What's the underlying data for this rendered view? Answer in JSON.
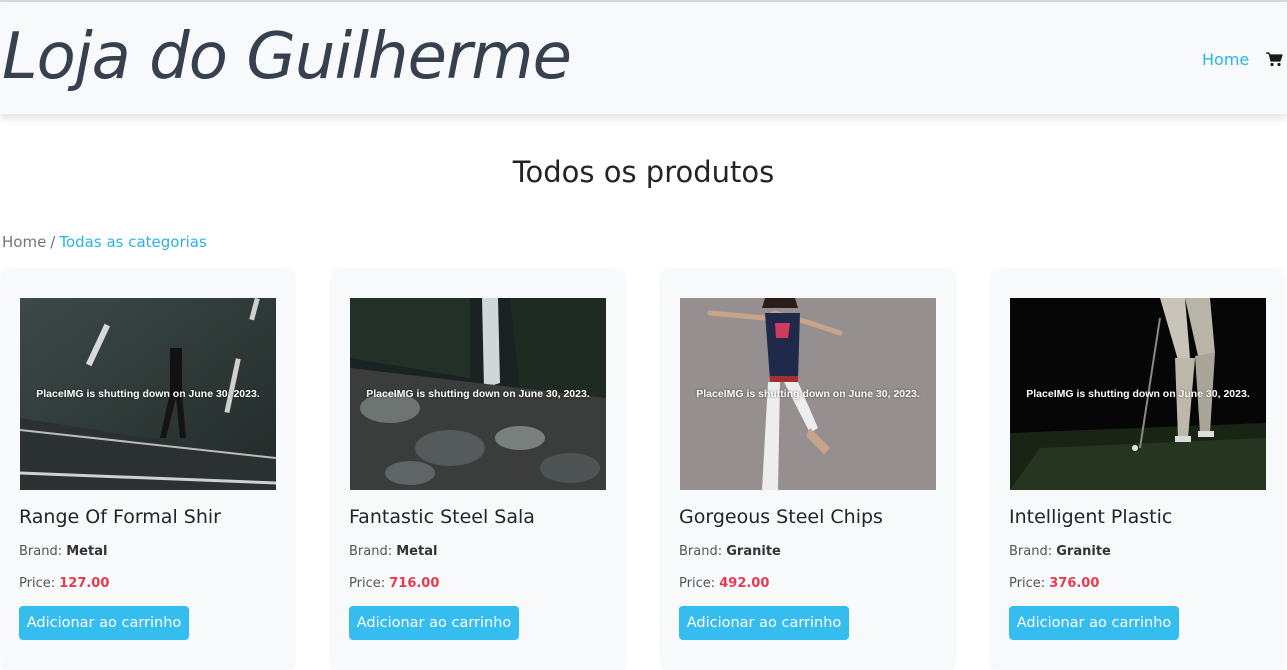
{
  "header": {
    "brand": "Loja do Guilherme",
    "nav_home": "Home",
    "cart_icon": "shopping-cart-icon"
  },
  "page": {
    "title": "Todos os produtos"
  },
  "breadcrumb": {
    "home": "Home",
    "separator": "/",
    "current": "Todas as categorias"
  },
  "labels": {
    "brand": "Brand:",
    "price": "Price:",
    "add_button": "Adicionar ao carrinho",
    "image_overlay": "PlaceIMG is shutting down on June 30, 2023."
  },
  "products": [
    {
      "name": "Range Of Formal Shir",
      "brand": "Metal",
      "price": "127.00",
      "image": "man-walking-on-road-photo"
    },
    {
      "name": "Fantastic Steel Sala",
      "brand": "Metal",
      "price": "716.00",
      "image": "waterfall-rocks-photo"
    },
    {
      "name": "Gorgeous Steel Chips",
      "brand": "Granite",
      "price": "492.00",
      "image": "woman-jumping-photo"
    },
    {
      "name": "Intelligent Plastic",
      "brand": "Granite",
      "price": "376.00",
      "image": "golfer-night-photo"
    }
  ],
  "colors": {
    "accent": "#36bdf0",
    "link": "#2bb3e8",
    "price": "#e83a4f",
    "brand_text": "#36404f"
  }
}
